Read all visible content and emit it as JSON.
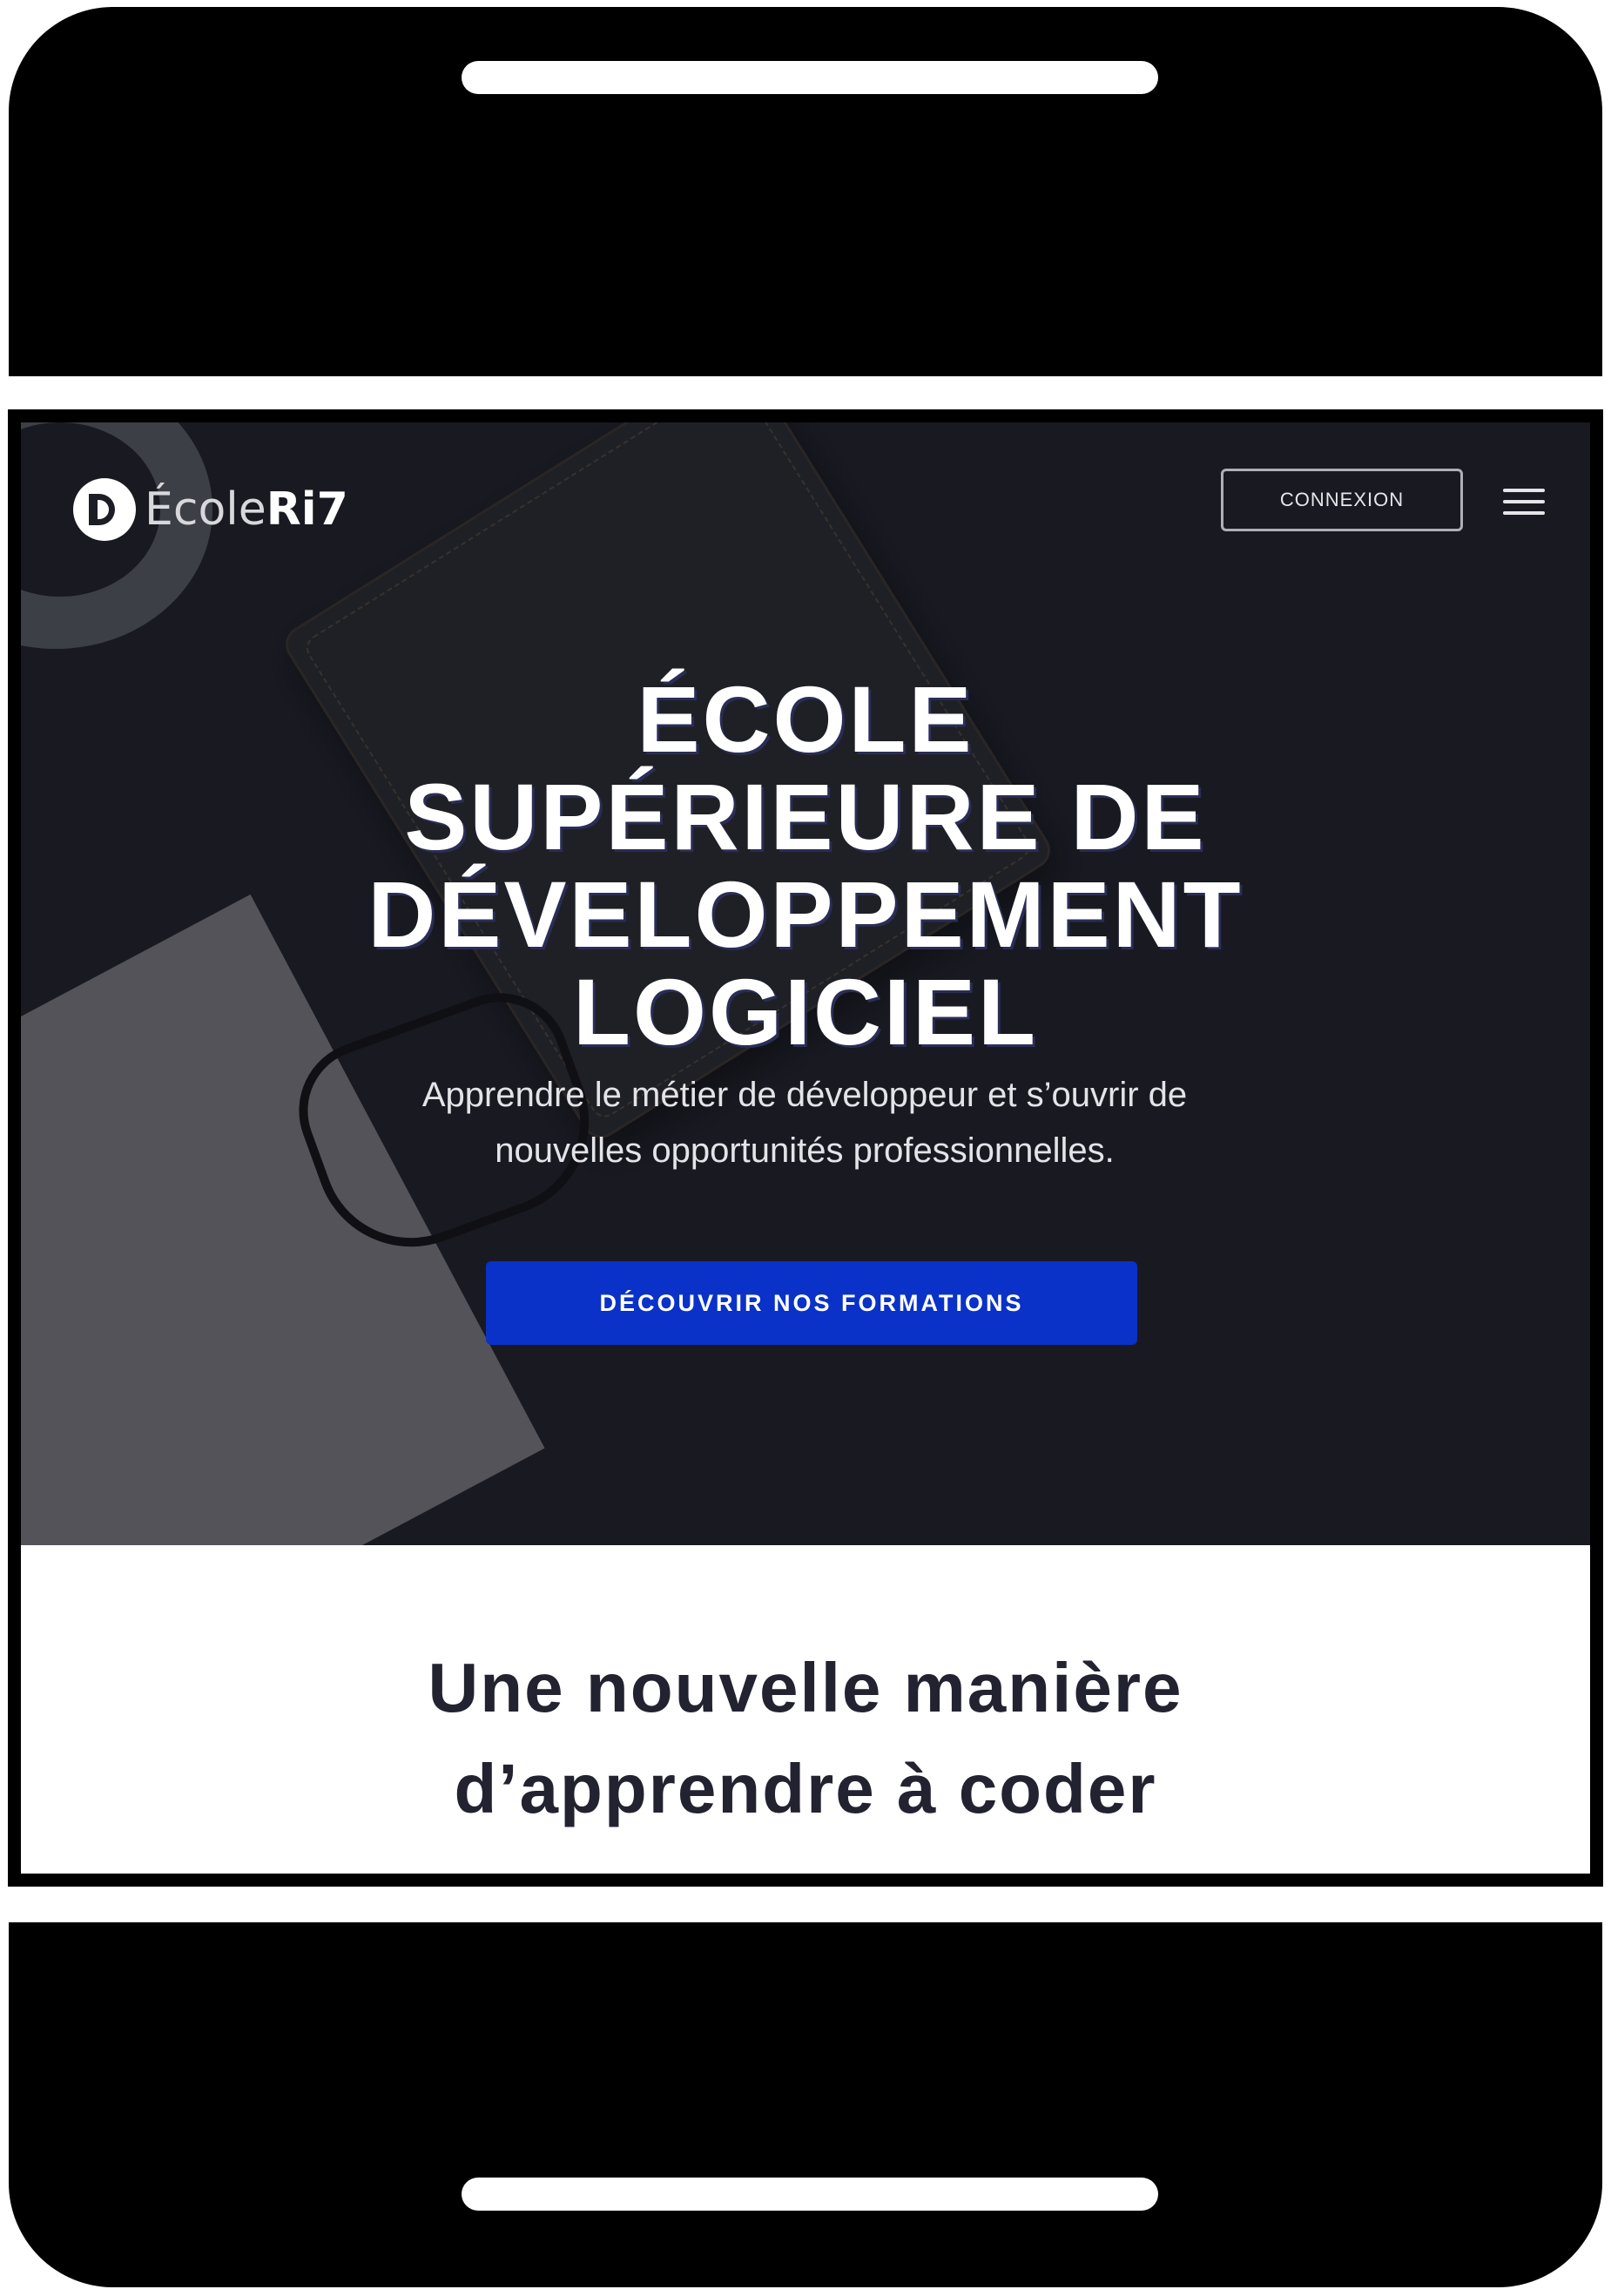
{
  "header": {
    "logo": {
      "text_light": "École",
      "text_bold": "Ri7"
    },
    "login_label": "CONNEXION",
    "menu_icon": "hamburger-menu-icon"
  },
  "hero": {
    "title_lines": [
      "ÉCOLE",
      "SUPÉRIEURE DE",
      "DÉVELOPPEMENT",
      "LOGICIEL"
    ],
    "subtitle_lines": [
      "Apprendre le métier de développeur et s’ouvrir de",
      "nouvelles opportunités professionnelles."
    ],
    "cta_label": "DÉCOUVRIR NOS FORMATIONS"
  },
  "section": {
    "title_lines": [
      "Une nouvelle manière",
      "d’apprendre à coder"
    ]
  },
  "colors": {
    "hero_background": "#1c1d25",
    "cta_background": "#0a32c8",
    "device_frame": "#000000"
  }
}
